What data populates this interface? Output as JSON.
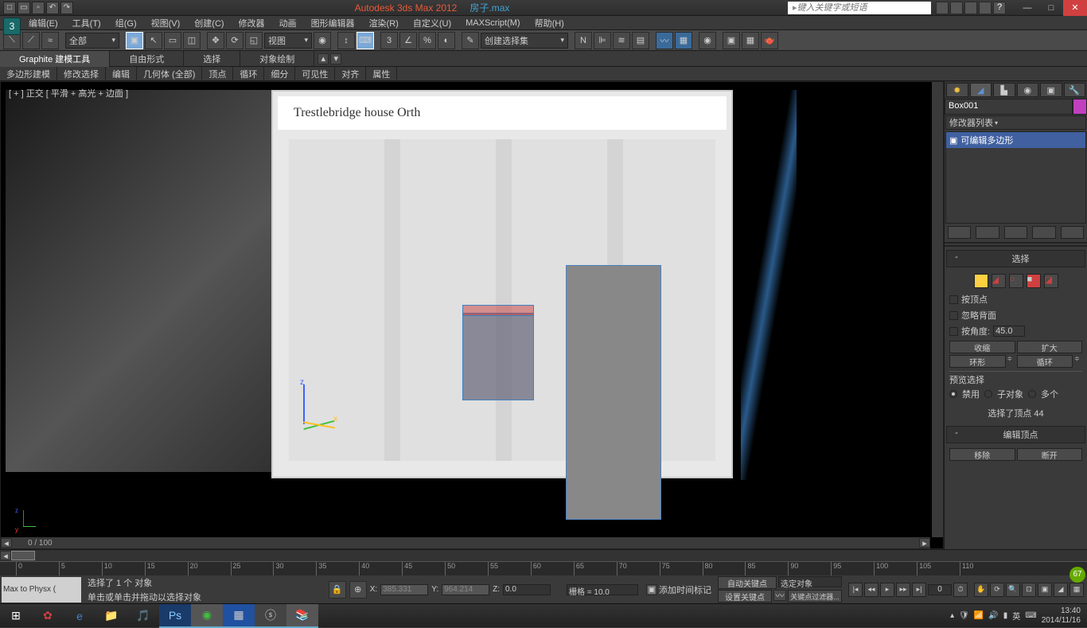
{
  "titlebar": {
    "app": "Autodesk 3ds Max  2012",
    "filename": "房子.max",
    "search_placeholder": "键入关键字或短语"
  },
  "menu": {
    "items": [
      "编辑(E)",
      "工具(T)",
      "组(G)",
      "视图(V)",
      "创建(C)",
      "修改器",
      "动画",
      "图形编辑器",
      "渲染(R)",
      "自定义(U)",
      "MAXScript(M)",
      "帮助(H)"
    ]
  },
  "toolbar": {
    "filter_all": "全部",
    "view": "视图",
    "selection_set": "创建选择集"
  },
  "ribbon": {
    "tabs": [
      "Graphite 建模工具",
      "自由形式",
      "选择",
      "对象绘制"
    ],
    "sub": [
      "多边形建模",
      "修改选择",
      "编辑",
      "几何体 (全部)",
      "顶点",
      "循环",
      "细分",
      "可见性",
      "对齐",
      "属性"
    ]
  },
  "viewport": {
    "label": "[ + ] 正交 [ 平滑 + 高光 + 边面 ]",
    "ref_title": "Trestlebridge  house Orth",
    "frame": "0 / 100"
  },
  "right_panel": {
    "object_name": "Box001",
    "modifier_dropdown": "修改器列表",
    "modifier_item": "可编辑多边形",
    "rollout_selection": "选择",
    "by_vertex": "按顶点",
    "ignore_backfacing": "忽略背面",
    "by_angle": "按角度:",
    "angle_value": "45.0",
    "shrink": "收缩",
    "grow": "扩大",
    "ring": "环形",
    "loop": "循环",
    "preview_sel": "预览选择",
    "disable": "禁用",
    "subobj": "子对象",
    "multi": "多个",
    "selected_info": "选择了顶点 44",
    "rollout_edit_vertex": "编辑顶点",
    "remove": "移除",
    "break": "断开"
  },
  "timeline": {
    "ticks": [
      0,
      5,
      10,
      15,
      20,
      25,
      30,
      35,
      40,
      45,
      50,
      55,
      60,
      65,
      70,
      75,
      80,
      85,
      90,
      95,
      100,
      105,
      110
    ]
  },
  "status": {
    "line1": "选择了 1 个 对象",
    "line2": "单击或单击并拖动以选择对象",
    "script_overlay": "Max to Physx (",
    "x_label": "X:",
    "y_label": "Y:",
    "z_label": "Z:",
    "x_val": "385.331",
    "y_val": "964.214",
    "z_val": "0.0",
    "grid": "栅格 = 10.0",
    "add_time_tag": "添加时间标记",
    "auto_key": "自动关键点",
    "set_key": "设置关键点",
    "sel_obj": "选定对象",
    "key_filter": "关键点过滤器..."
  },
  "taskbar": {
    "time": "13:40",
    "date": "2014/11/16",
    "ime": "英",
    "badge": "67"
  }
}
